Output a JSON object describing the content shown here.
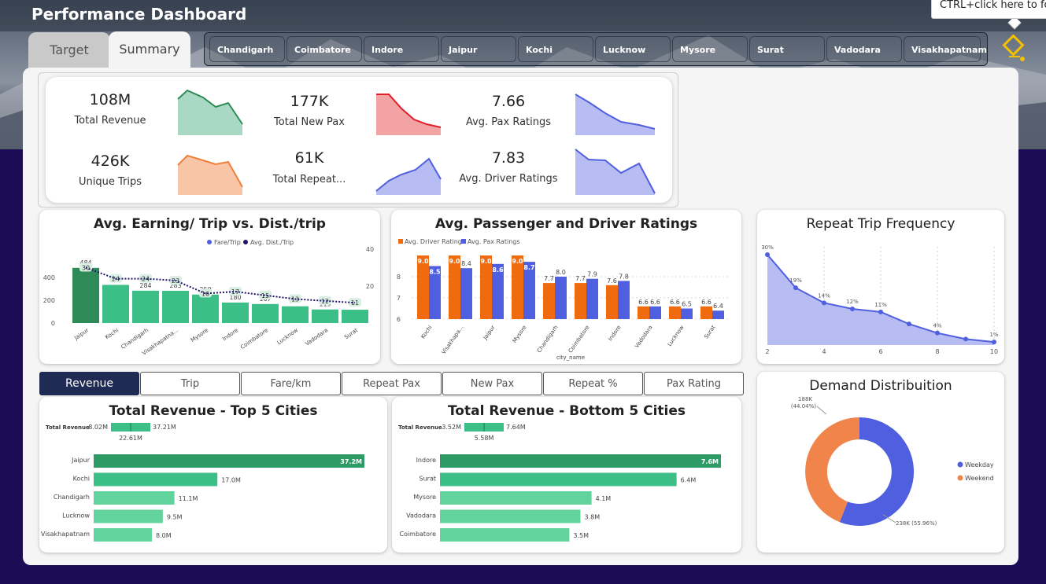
{
  "header": {
    "title": "Performance Dashboard",
    "tooltip": "CTRL+click here to fo"
  },
  "tabs": [
    {
      "label": "Target"
    },
    {
      "label": "Summary"
    }
  ],
  "cities": [
    "Chandigarh",
    "Coimbatore",
    "Indore",
    "Jaipur",
    "Kochi",
    "Lucknow",
    "Mysore",
    "Surat",
    "Vadodara",
    "Visakhapatnam"
  ],
  "kpis": [
    {
      "value": "108M",
      "label": "Total Revenue",
      "color": "#2e8b57"
    },
    {
      "value": "177K",
      "label": "Total New Pax",
      "color": "#e01e2b"
    },
    {
      "value": "7.66",
      "label": "Avg. Pax Ratings",
      "color": "#4f5fe0"
    },
    {
      "value": "426K",
      "label": "Unique Trips",
      "color": "#f07f3c"
    },
    {
      "value": "61K",
      "label": "Total Repeat...",
      "color": "#4f5fe0"
    },
    {
      "value": "7.83",
      "label": "Avg. Driver Ratings",
      "color": "#4f5fe0"
    }
  ],
  "metric_tabs": [
    {
      "label": "Revenue",
      "active": true
    },
    {
      "label": "Trip"
    },
    {
      "label": "Fare/km"
    },
    {
      "label": "Repeat Pax"
    },
    {
      "label": "New Pax"
    },
    {
      "label": "Repeat %"
    },
    {
      "label": "Pax Rating"
    }
  ],
  "chart_data": [
    {
      "type": "bar",
      "title": "Avg. Earning/ Trip vs. Dist./trip",
      "legend": [
        "Fare/Trip",
        "Avg. Dist./Trip"
      ],
      "categories": [
        "Jaipur",
        "Kochi",
        "Chandigarh",
        "Visakhapatna...",
        "Mysore",
        "Indore",
        "Coimbatore",
        "Lucknow",
        "Vadodara",
        "Surat"
      ],
      "series": [
        {
          "name": "Fare/Trip",
          "values": [
            484,
            335,
            284,
            283,
            250,
            180,
            167,
            147,
            119,
            117
          ]
        },
        {
          "name": "Avg. Dist./Trip",
          "values": [
            30,
            24,
            24,
            23,
            16,
            17,
            15,
            13,
            12,
            11
          ]
        }
      ],
      "y_ticks": [
        "0",
        "200",
        "400"
      ],
      "y2_ticks": [
        "20",
        "40"
      ]
    },
    {
      "type": "bar",
      "title": "Avg. Passenger and Driver Ratings",
      "legend": [
        "Avg. Driver Ratings",
        "Avg. Pax Ratings"
      ],
      "xlabel": "city_name",
      "categories": [
        "Kochi",
        "Visakhapa...",
        "Jaipur",
        "Mysore",
        "Chandigarh",
        "Coimbatore",
        "Indore",
        "Vadodara",
        "Lucknow",
        "Surat"
      ],
      "series": [
        {
          "name": "Avg. Driver Ratings",
          "values": [
            9.0,
            9.0,
            9.0,
            9.0,
            7.7,
            7.7,
            7.6,
            6.6,
            6.6,
            6.6
          ]
        },
        {
          "name": "Avg. Pax Ratings",
          "values": [
            8.5,
            8.4,
            8.6,
            8.7,
            8.0,
            7.9,
            7.8,
            6.6,
            6.5,
            6.4
          ]
        }
      ],
      "y_ticks": [
        "6",
        "7",
        "8"
      ],
      "ylim": [
        6,
        9.6
      ]
    },
    {
      "type": "area",
      "title": "Repeat Trip Frequency",
      "x": [
        2,
        3,
        4,
        5,
        6,
        7,
        8,
        9,
        10
      ],
      "values": [
        30,
        19,
        14,
        12,
        11,
        7,
        4,
        2,
        1
      ],
      "labels": [
        "30%",
        "19%",
        "14%",
        "12%",
        "11%",
        "",
        "4%",
        "",
        "1%"
      ],
      "x_ticks": [
        "2",
        "4",
        "6",
        "8",
        "10"
      ]
    },
    {
      "type": "bar",
      "title": "Total Revenue - Top 5 Cities",
      "legend_label": "Total Revenue",
      "range": {
        "min": "8.02M",
        "max": "37.21M",
        "avg": "22.61M"
      },
      "categories": [
        "Jaipur",
        "Kochi",
        "Chandigarh",
        "Lucknow",
        "Visakhapatnam"
      ],
      "values": [
        37.2,
        17.0,
        11.1,
        9.5,
        8.0
      ],
      "labels": [
        "37.2M",
        "17.0M",
        "11.1M",
        "9.5M",
        "8.0M"
      ]
    },
    {
      "type": "bar",
      "title": "Total Revenue - Bottom 5 Cities",
      "legend_label": "Total Revenue",
      "range": {
        "min": "3.52M",
        "max": "7.64M",
        "avg": "5.58M"
      },
      "categories": [
        "Indore",
        "Surat",
        "Mysore",
        "Vadodara",
        "Coimbatore"
      ],
      "values": [
        7.6,
        6.4,
        4.1,
        3.8,
        3.5
      ],
      "labels": [
        "7.6M",
        "6.4M",
        "4.1M",
        "3.8M",
        "3.5M"
      ]
    },
    {
      "type": "pie",
      "title": "Demand Distribuition",
      "categories": [
        "Weekday",
        "Weekend"
      ],
      "values": [
        55.96,
        44.04
      ],
      "labels": [
        "238K (55.96%)",
        "188K (44.04%)"
      ],
      "colors": [
        "#4f5fe0",
        "#f0844a"
      ]
    }
  ]
}
